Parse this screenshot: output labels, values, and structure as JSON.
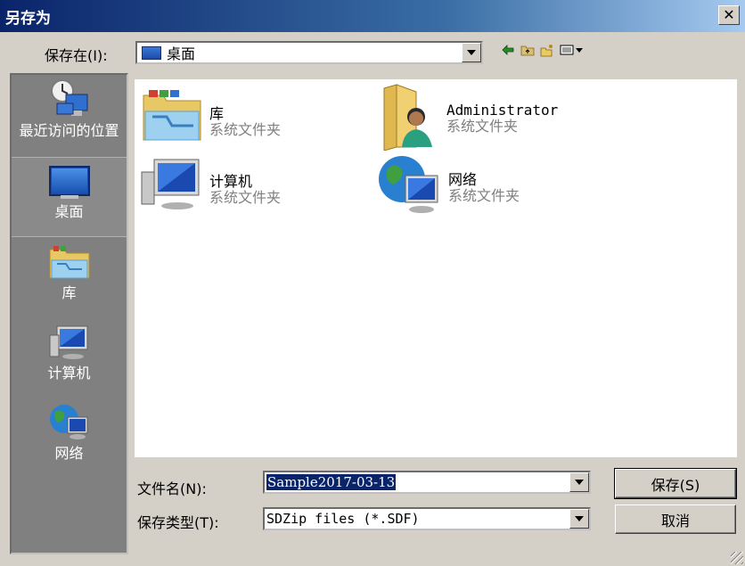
{
  "window": {
    "title": "另存为"
  },
  "lookin": {
    "label": "保存在(I):",
    "value": "桌面"
  },
  "toolbar": {
    "icons": [
      "back-arrow-icon",
      "up-folder-icon",
      "new-folder-icon",
      "view-menu-icon"
    ]
  },
  "places": [
    {
      "label": "最近访问的位置",
      "icon": "recent-places-icon"
    },
    {
      "label": "桌面",
      "icon": "desktop-icon"
    },
    {
      "label": "库",
      "icon": "libraries-icon"
    },
    {
      "label": "计算机",
      "icon": "computer-icon"
    },
    {
      "label": "网络",
      "icon": "network-icon"
    }
  ],
  "files": [
    {
      "name": "库",
      "type": "系统文件夹",
      "icon": "libraries-icon"
    },
    {
      "name": "Administrator",
      "type": "系统文件夹",
      "icon": "user-folder-icon"
    },
    {
      "name": "计算机",
      "type": "系统文件夹",
      "icon": "computer-icon"
    },
    {
      "name": "网络",
      "type": "系统文件夹",
      "icon": "network-icon"
    }
  ],
  "filename": {
    "label": "文件名(N):",
    "value": "Sample2017-03-13"
  },
  "filetype": {
    "label": "保存类型(T):",
    "value": "SDZip files (*.SDF)"
  },
  "buttons": {
    "save": "保存(S)",
    "cancel": "取消"
  },
  "colors": {
    "title_start": "#0a246a",
    "title_end": "#a6caf0",
    "selection": "#0a246a",
    "dialog_bg": "#d4d0c8"
  }
}
